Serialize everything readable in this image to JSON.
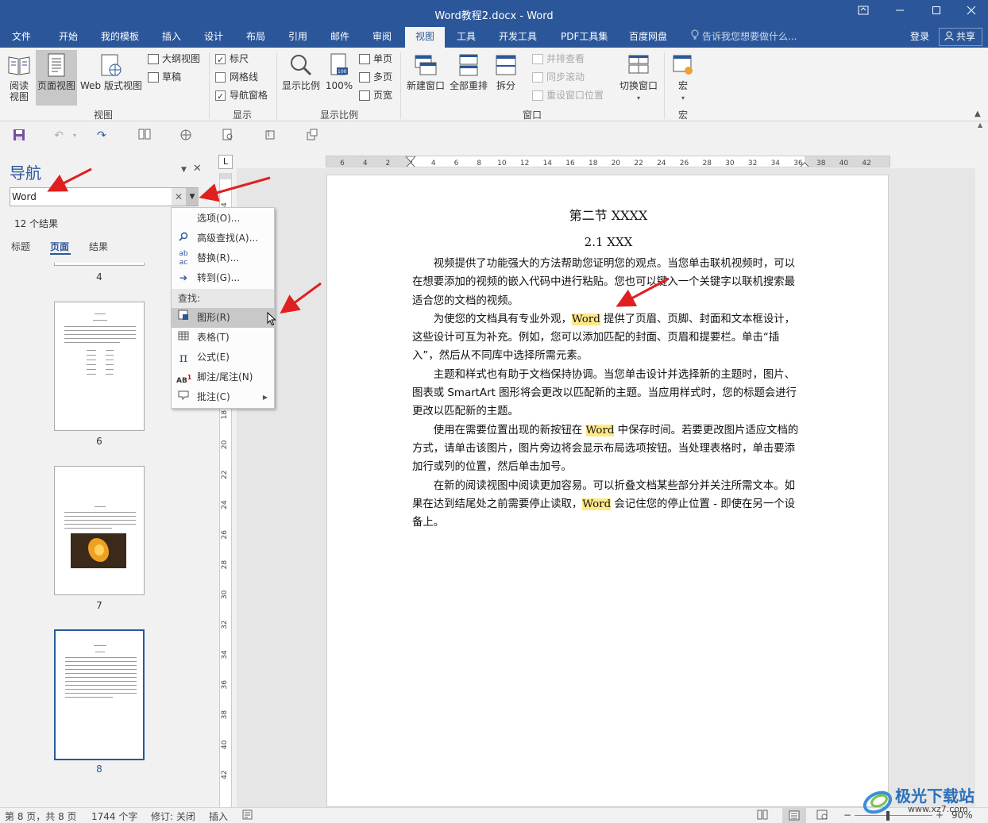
{
  "window": {
    "title": "Word教程2.docx - Word",
    "controls": [
      "restore",
      "minimize",
      "maximize",
      "close"
    ]
  },
  "tabs": [
    {
      "label": "文件"
    },
    {
      "label": "开始"
    },
    {
      "label": "我的模板"
    },
    {
      "label": "插入"
    },
    {
      "label": "设计"
    },
    {
      "label": "布局"
    },
    {
      "label": "引用"
    },
    {
      "label": "邮件"
    },
    {
      "label": "审阅"
    },
    {
      "label": "视图",
      "active": true
    },
    {
      "label": "工具"
    },
    {
      "label": "开发工具"
    },
    {
      "label": "PDF工具集"
    },
    {
      "label": "百度网盘"
    }
  ],
  "tell_me": "告诉我您想要做什么...",
  "login": "登录",
  "share": "共享",
  "ribbon": {
    "views": {
      "group": "视图",
      "read_mode": "阅读\n视图",
      "print_layout": "页面视图",
      "web_layout": "Web 版式视图",
      "outline": "大纲视图",
      "draft": "草稿"
    },
    "show": {
      "group": "显示",
      "ruler": {
        "label": "标尺",
        "checked": true
      },
      "gridlines": {
        "label": "网格线",
        "checked": false
      },
      "nav_pane": {
        "label": "导航窗格",
        "checked": true
      }
    },
    "zoom": {
      "group": "显示比例",
      "zoom": "显示比例",
      "hundred": "100%",
      "one_page": "单页",
      "multi_page": "多页",
      "page_width": "页宽"
    },
    "window": {
      "group": "窗口",
      "new_window": "新建窗口",
      "arrange_all": "全部重排",
      "split": "拆分",
      "side_by_side": "并排查看",
      "sync_scroll": "同步滚动",
      "reset_position": "重设窗口位置",
      "switch": "切换窗口"
    },
    "macros": {
      "group": "宏",
      "macros": "宏"
    }
  },
  "nav": {
    "title": "导航",
    "search_value": "Word",
    "results": "12 个结果",
    "tabs": [
      "标题",
      "页面",
      "结果"
    ],
    "active_tab": "页面",
    "pages": [
      "4",
      "6",
      "7",
      "8"
    ],
    "selected_page": "8"
  },
  "menu": {
    "items": [
      {
        "label": "选项(O)...",
        "icon": "none"
      },
      {
        "label": "高级查找(A)...",
        "icon": "magnifier-icon"
      },
      {
        "label": "替换(R)...",
        "icon": "replace-icon"
      },
      {
        "label": "转到(G)...",
        "icon": "arrow-right-icon"
      }
    ],
    "find_header": "查找:",
    "find_items": [
      {
        "label": "图形(R)",
        "icon": "graphic-icon",
        "highlighted": true
      },
      {
        "label": "表格(T)",
        "icon": "table-icon"
      },
      {
        "label": "公式(E)",
        "icon": "pi-icon"
      },
      {
        "label": "脚注/尾注(N)",
        "icon": "footnote-icon"
      },
      {
        "label": "批注(C)",
        "icon": "comment-icon",
        "submenu": true
      }
    ]
  },
  "ruler": {
    "h_ticks": [
      "6",
      "4",
      "2",
      "2",
      "4",
      "6",
      "8",
      "10",
      "12",
      "14",
      "16",
      "18",
      "20",
      "22",
      "24",
      "26",
      "28",
      "30",
      "32",
      "34",
      "36",
      "38",
      "40",
      "42"
    ],
    "v_ticks": [
      "4",
      "6",
      "8",
      "10",
      "12",
      "14",
      "16",
      "18",
      "20",
      "22",
      "24",
      "26",
      "28",
      "30",
      "32",
      "34",
      "36",
      "38",
      "40",
      "42"
    ],
    "tab_stop": "L"
  },
  "document": {
    "heading1": "第二节  XXXX",
    "heading2": "2.1 XXX",
    "paragraphs": [
      {
        "parts": [
          {
            "t": "视频提供了功能强大的方法帮助您证明您的观点。当您单击联机视频时，可以在想要添加的视频的嵌入代码中进行粘贴。您也可以键入一个关键字以联机搜索最适合您的文档的视频。"
          }
        ]
      },
      {
        "parts": [
          {
            "t": "为使您的文档具有专业外观，"
          },
          {
            "t": "Word",
            "hl": true
          },
          {
            "t": " 提供了页眉、页脚、封面和文本框设计，这些设计可互为补充。例如，您可以添加匹配的封面、页眉和提要栏。单击“插入”，然后从不同库中选择所需元素。"
          }
        ]
      },
      {
        "parts": [
          {
            "t": "主题和样式也有助于文档保持协调。当您单击设计并选择新的主题时，图片、图表或 SmartArt 图形将会更改以匹配新的主题。当应用样式时，您的标题会进行更改以匹配新的主题。"
          }
        ]
      },
      {
        "parts": [
          {
            "t": "使用在需要位置出现的新按钮在 "
          },
          {
            "t": "Word",
            "hl": true
          },
          {
            "t": " 中保存时间。若要更改图片适应文档的方式，请单击该图片，图片旁边将会显示布局选项按钮。当处理表格时，单击要添加行或列的位置，然后单击加号。"
          }
        ]
      },
      {
        "parts": [
          {
            "t": "在新的阅读视图中阅读更加容易。可以折叠文档某些部分并关注所需文本。如果在达到结尾处之前需要停止读取，"
          },
          {
            "t": "Word",
            "hl": true
          },
          {
            "t": " 会记住您的停止位置 - 即使在另一个设备上。"
          }
        ]
      }
    ]
  },
  "status": {
    "page": "第 8 页，共 8 页",
    "words": "1744 个字",
    "track": "修订: 关闭",
    "insert": "插入",
    "zoom": "90%"
  },
  "watermark": {
    "name": "极光下载站",
    "url": "www.xz7.com"
  },
  "colors": {
    "brand": "#2b579a",
    "highlight": "#ffe888",
    "arrow": "#e02020"
  }
}
